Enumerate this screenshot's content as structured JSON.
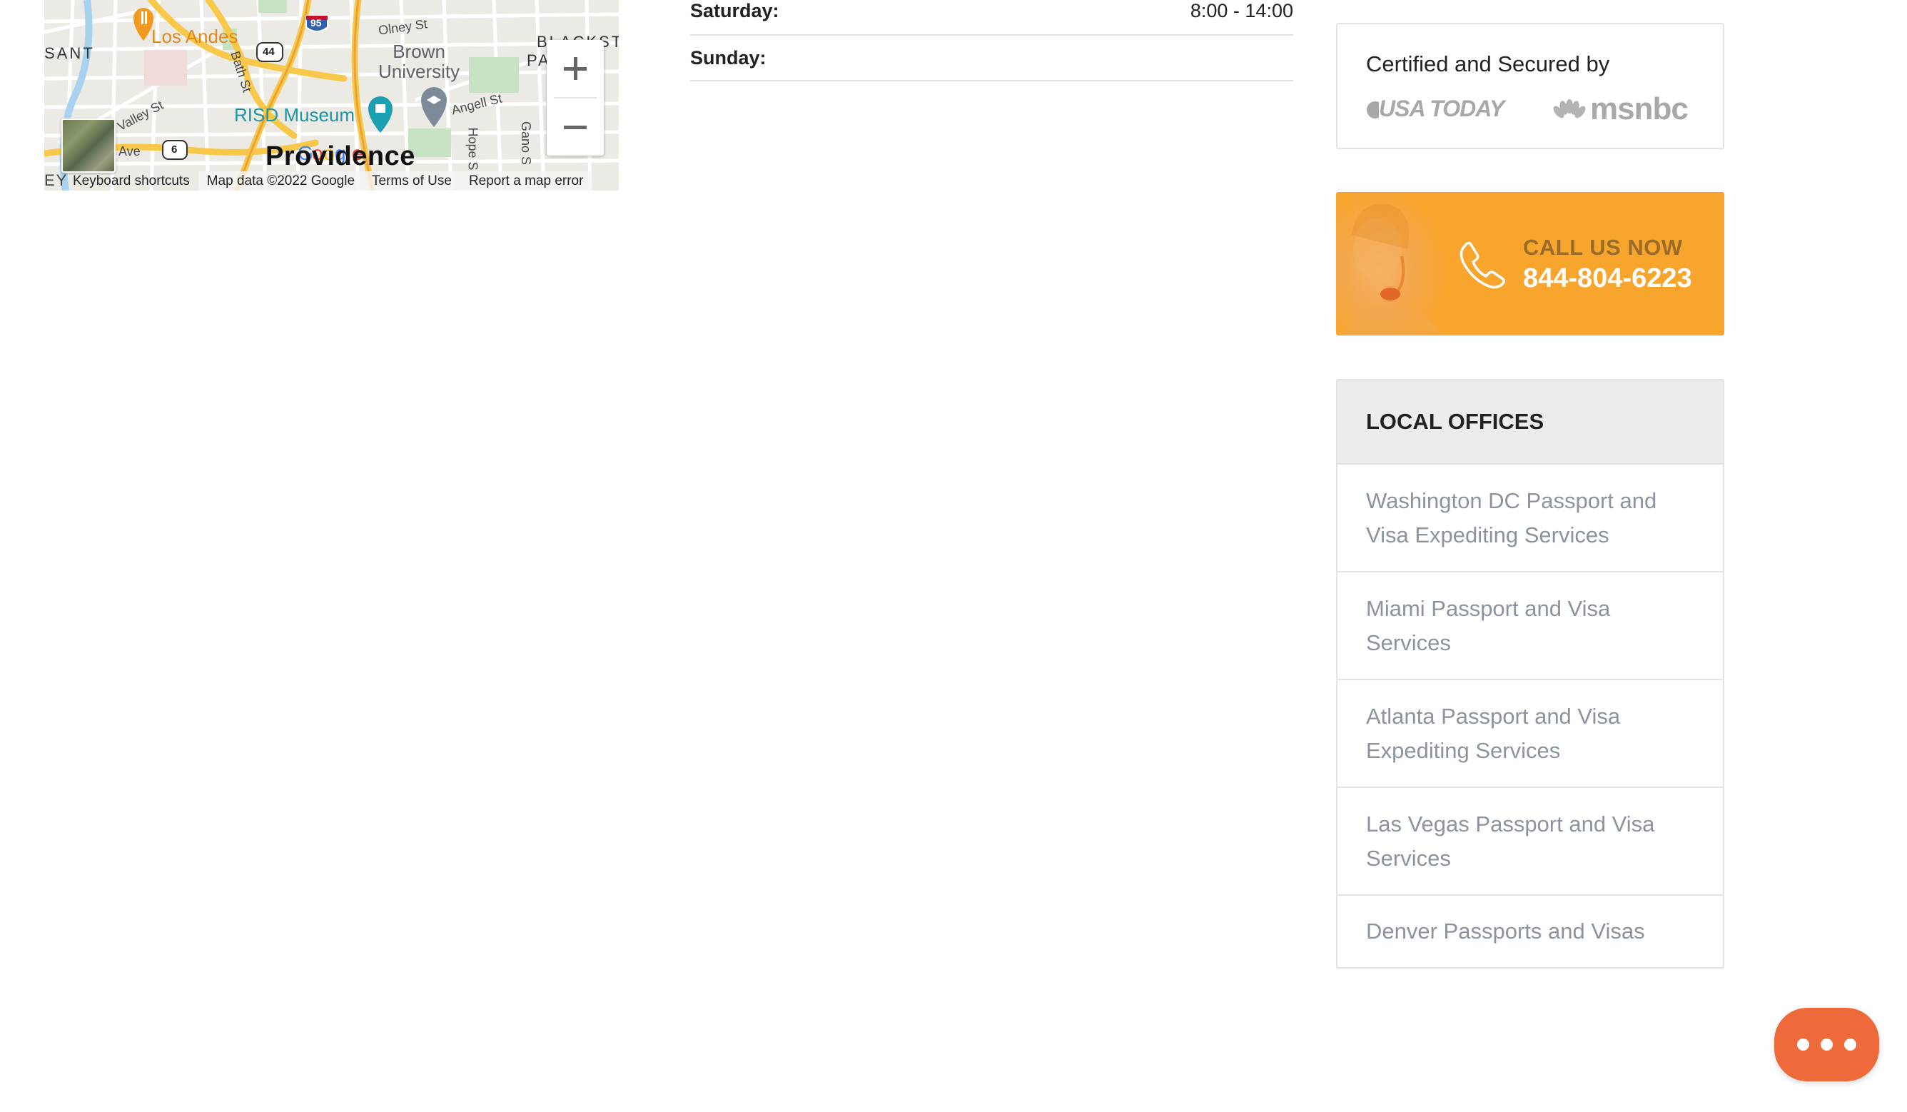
{
  "map": {
    "labels": {
      "los_andes": "Los Andes",
      "olney": "Olney St",
      "brown": "Brown\nUniversity",
      "risd": "RISD Museum",
      "angell": "Angell St",
      "valley": "Valley St",
      "bath": "Bath St",
      "hope": "Hope S",
      "gano": "Gano S",
      "providence": "Providence",
      "ant": "SANT",
      "blackstone": "BLACKST",
      "pa": "PA",
      "ave": "Ave",
      "ey": "EY",
      "hw95": "95",
      "hw44": "44",
      "hw6": "6",
      "google": "Google"
    },
    "footer": {
      "shortcuts": "Keyboard shortcuts",
      "data": "Map data ©2022 Google",
      "terms": "Terms of Use",
      "report": "Report a map error"
    }
  },
  "hours": [
    {
      "day": "Saturday:",
      "time": "8:00 - 14:00"
    },
    {
      "day": "Sunday:",
      "time": ""
    }
  ],
  "certified": {
    "title": "Certified and Secured by",
    "logos": [
      "USA TODAY",
      "msnbc"
    ]
  },
  "callus": {
    "cta": "CALL US NOW",
    "phone": "844-804-6223"
  },
  "offices": {
    "title": "LOCAL OFFICES",
    "items": [
      "Washington DC Passport and Visa Expediting Services",
      "Miami Passport and Visa Services",
      "Atlanta Passport and Visa Expediting Services",
      "Las Vegas Passport and Visa Services",
      "Denver Passports and Visas"
    ]
  },
  "colors": {
    "accent_orange": "#f8a52e",
    "chat_orange": "#ef6a3b",
    "office_link": "#8b949e"
  }
}
